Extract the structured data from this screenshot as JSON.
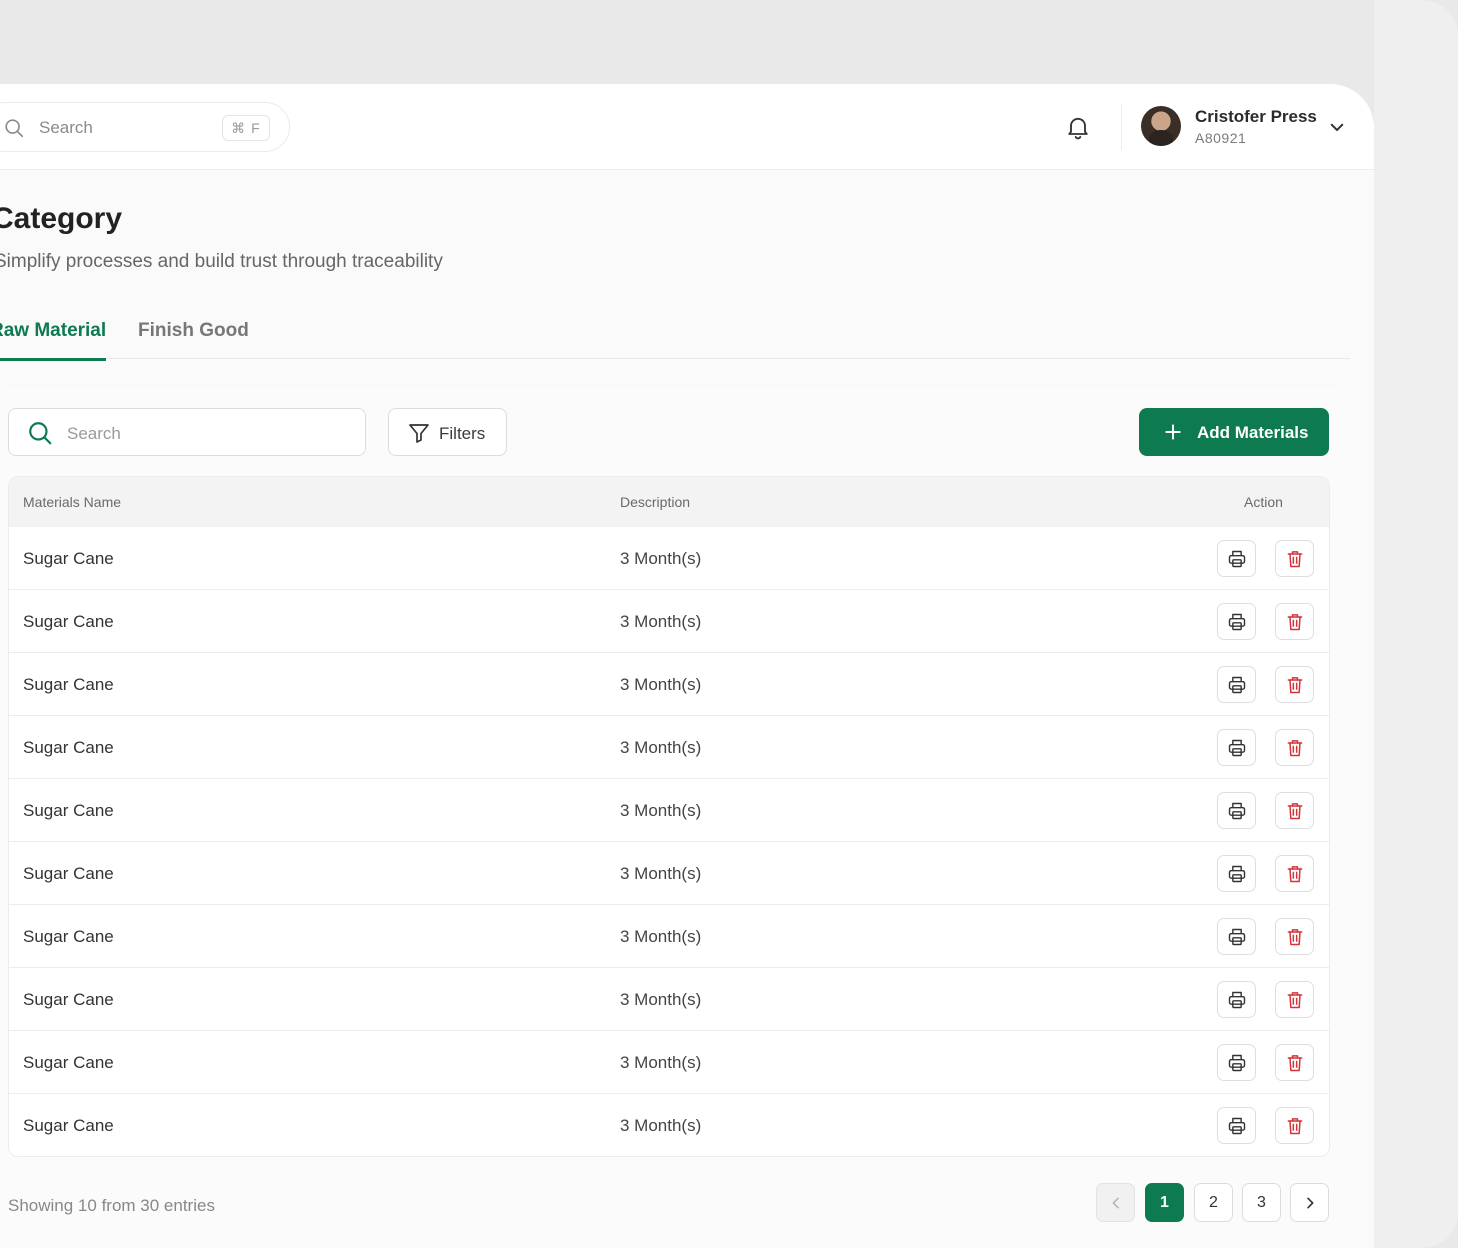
{
  "header": {
    "search_placeholder": "Search",
    "search_shortcut": "⌘ F",
    "user": {
      "name": "Cristofer Press",
      "id": "A80921"
    }
  },
  "page": {
    "title": "Category",
    "subtitle": "Simplify processes and build trust through traceability"
  },
  "tabs": [
    {
      "label": "Raw Material",
      "active": true
    },
    {
      "label": "Finish Good",
      "active": false
    }
  ],
  "toolbar": {
    "search_placeholder": "Search",
    "filters_label": "Filters",
    "add_label": "Add Materials"
  },
  "table": {
    "columns": [
      "Materials Name",
      "Description",
      "Action"
    ],
    "rows": [
      {
        "name": "Sugar Cane",
        "description": "3 Month(s)"
      },
      {
        "name": "Sugar Cane",
        "description": "3 Month(s)"
      },
      {
        "name": "Sugar Cane",
        "description": "3 Month(s)"
      },
      {
        "name": "Sugar Cane",
        "description": "3 Month(s)"
      },
      {
        "name": "Sugar Cane",
        "description": "3 Month(s)"
      },
      {
        "name": "Sugar Cane",
        "description": "3 Month(s)"
      },
      {
        "name": "Sugar Cane",
        "description": "3 Month(s)"
      },
      {
        "name": "Sugar Cane",
        "description": "3 Month(s)"
      },
      {
        "name": "Sugar Cane",
        "description": "3 Month(s)"
      },
      {
        "name": "Sugar Cane",
        "description": "3 Month(s)"
      }
    ]
  },
  "footer": {
    "entries_text": "Showing 10 from 30 entries",
    "pages": [
      "1",
      "2",
      "3"
    ],
    "current_page": "1"
  },
  "theme": {
    "accent": "#0d7a50",
    "danger": "#d3343a"
  },
  "icons": {
    "row_actions": [
      "printer-icon",
      "trash-icon"
    ],
    "toolbar": [
      "search-icon",
      "filter-icon",
      "plus-icon"
    ],
    "header": [
      "search-icon",
      "bell-icon",
      "chevron-down-icon"
    ]
  }
}
